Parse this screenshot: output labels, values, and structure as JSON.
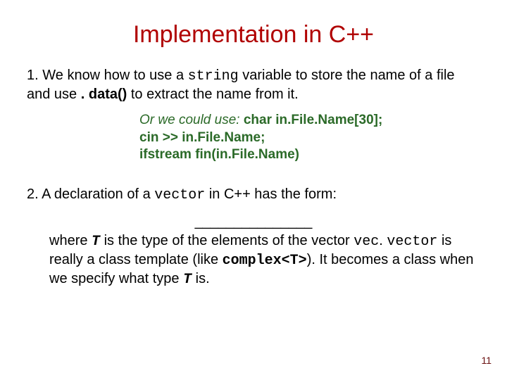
{
  "title": "Implementation in C++",
  "item1": {
    "num": "1.",
    "pre": " We know how to use a ",
    "code1": "string",
    "mid": " variable to store the name of a file and use ",
    "code2": ". data()",
    "post": " to extract the name from it."
  },
  "green": {
    "line1a": "Or we could use:  ",
    "line1b": "char in.File.Name[30];",
    "line2": "cin >> in.File.Name;",
    "line3": "ifstream fin(in.File.Name)"
  },
  "item2": {
    "num": "2.",
    "pre": " A declaration of a ",
    "code1": "vector",
    "post": " in C++ has the form:"
  },
  "blank": "_______________",
  "where": {
    "a": "where ",
    "T1": "T",
    "b": " is the type of the elements of the vector ",
    "vec": "vec",
    "c": ". ",
    "vector": "vector",
    "d": " is really a class template (like ",
    "complex": "complex<T>",
    "e": "). It becomes a class when we specify what type ",
    "T2": "T",
    "f": " is."
  },
  "page": "11"
}
